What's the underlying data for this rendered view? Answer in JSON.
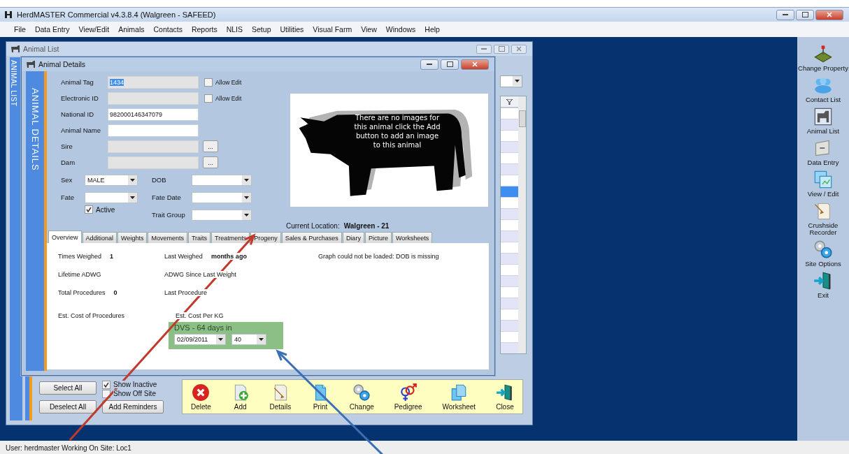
{
  "app": {
    "title": "HerdMASTER Commercial  v4.3.8.4 (Walgreen - SAFEED)"
  },
  "menu": [
    "File",
    "Data Entry",
    "View/Edit",
    "Animals",
    "Contacts",
    "Reports",
    "NLIS",
    "Setup",
    "Utilities",
    "Visual Farm",
    "View",
    "Windows",
    "Help"
  ],
  "animal_list": {
    "title": "Animal List",
    "side_label": "ANIMAL LIST",
    "grid_rows": [
      {
        "selected": false
      },
      {
        "selected": false
      },
      {
        "selected": false
      },
      {
        "selected": false
      },
      {
        "selected": false
      },
      {
        "selected": false
      },
      {
        "selected": false
      },
      {
        "selected": true
      },
      {
        "selected": false
      },
      {
        "selected": false
      },
      {
        "selected": false
      },
      {
        "selected": false
      },
      {
        "selected": false
      },
      {
        "selected": false
      },
      {
        "selected": false
      },
      {
        "selected": false
      },
      {
        "selected": false
      },
      {
        "selected": false
      },
      {
        "selected": false
      },
      {
        "selected": false
      },
      {
        "selected": false
      },
      {
        "selected": false
      }
    ],
    "buttons": [
      "Select All",
      "Deselect All"
    ],
    "checkboxes": [
      {
        "label": "Show Inactive",
        "checked": true
      },
      {
        "label": "Show Off Site",
        "checked": false
      }
    ],
    "reminder_button": "Add Reminders",
    "toolbar": [
      {
        "kind": "delete",
        "label": "Delete"
      },
      {
        "kind": "add",
        "label": "Add"
      },
      {
        "kind": "details",
        "label": "Details"
      },
      {
        "kind": "print",
        "label": "Print"
      },
      {
        "kind": "change",
        "label": "Change"
      },
      {
        "kind": "pedigree",
        "label": "Pedigree"
      },
      {
        "kind": "worksheet",
        "label": "Worksheet"
      },
      {
        "kind": "close",
        "label": "Close"
      }
    ]
  },
  "animal_details": {
    "title": "Animal Details",
    "side_label": "ANIMAL DETAILS",
    "fields": [
      {
        "kind": "text",
        "label": "Animal Tag",
        "value": "1434",
        "disabled": true,
        "value_selected": true,
        "allow_edit": {
          "label": "Allow Edit",
          "checked": false
        }
      },
      {
        "kind": "text",
        "label": "Electronic ID",
        "disabled": true,
        "allow_edit": {
          "label": "Allow Edit",
          "checked": false
        }
      },
      {
        "kind": "text",
        "label": "National ID",
        "value": "982000146347079",
        "disabled": false
      },
      {
        "kind": "text",
        "label": "Animal Name",
        "disabled": false
      },
      {
        "kind": "lookup",
        "label": "Sire",
        "disabled": true,
        "button": "..."
      },
      {
        "kind": "lookup",
        "label": "Dam",
        "disabled": true,
        "button": "..."
      }
    ],
    "left_column": [
      {
        "kind": "dropdown",
        "label": "Sex",
        "value": "MALE"
      },
      {
        "kind": "dropdown",
        "label": "Fate"
      },
      {
        "kind": "checkbox",
        "label": "Active",
        "checked": true
      }
    ],
    "right_column": [
      {
        "kind": "dropdown",
        "label": "DOB"
      },
      {
        "kind": "dropdown",
        "label": "Fate Date"
      },
      {
        "kind": "dropdown",
        "label": "Trait Group"
      }
    ],
    "image_message": "There are no images for this animal click the Add button to add an image to this animal",
    "location_label": "Current Location:",
    "location": "Walgreen - 21",
    "tabs": [
      {
        "label": "Overview",
        "selected": true
      },
      {
        "label": "Additional",
        "selected": false
      },
      {
        "label": "Weights",
        "selected": false
      },
      {
        "label": "Movements",
        "selected": false
      },
      {
        "label": "Traits",
        "selected": false
      },
      {
        "label": "Treatments",
        "selected": false
      },
      {
        "label": "Progeny",
        "selected": false
      },
      {
        "label": "Sales & Purchases",
        "selected": false
      },
      {
        "label": "Diary",
        "selected": false
      },
      {
        "label": "Picture",
        "selected": false
      },
      {
        "label": "Worksheets",
        "selected": false
      }
    ],
    "overview": {
      "left": [
        {
          "label": "Times Weighed",
          "value": "1"
        },
        {
          "label": "Lifetime ADWG"
        },
        {
          "label": "Total Procedures",
          "value": "0"
        },
        {
          "label": "Est. Cost of Procedures"
        }
      ],
      "right": [
        {
          "label": "Last Weighed",
          "value": "months ago"
        },
        {
          "label": "ADWG Since Last Weight"
        },
        {
          "label": "Last Procedure"
        },
        {
          "label": "Est. Cost Per KG"
        }
      ],
      "graph_message": "Graph could not be loaded: DOB is missing",
      "dvs": {
        "title": "DVS - 64 days in",
        "date": "02/09/2011",
        "days": "40"
      }
    }
  },
  "side_panel": [
    {
      "kind": "property",
      "label": "Change Property"
    },
    {
      "kind": "contacts",
      "label": "Contact List"
    },
    {
      "kind": "animals",
      "label": "Animal List"
    },
    {
      "kind": "data-entry",
      "label": "Data Entry"
    },
    {
      "kind": "view-edit",
      "label": "View / Edit"
    },
    {
      "kind": "recorder",
      "label": "Crushside Recorder"
    },
    {
      "kind": "site-options",
      "label": "Site Options"
    },
    {
      "kind": "exit",
      "label": "Exit"
    }
  ],
  "status_bar": "User: herdmaster  Working On Site: Loc1",
  "annotations": [
    {
      "color": "#c0392b"
    },
    {
      "color": "#3a6fb5"
    }
  ]
}
